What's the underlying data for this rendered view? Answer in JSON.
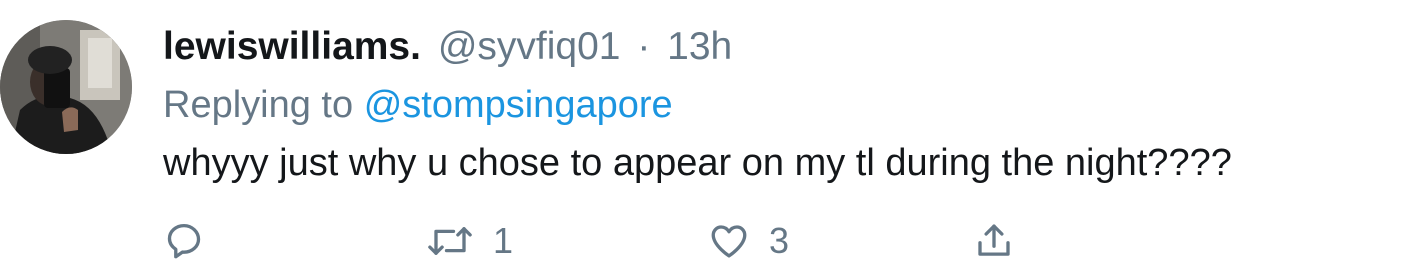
{
  "tweet": {
    "display_name": "lewiswilliams.",
    "handle": "@syvfiq01",
    "separator": "·",
    "time": "13h",
    "replying_prefix": "Replying to",
    "replying_handle": "@stompsingapore",
    "text": "whyyy just why u chose to appear on my tl during the night????"
  },
  "actions": {
    "reply": {
      "icon": "reply-icon",
      "count": ""
    },
    "retweet": {
      "icon": "retweet-icon",
      "count": "1"
    },
    "like": {
      "icon": "heart-icon",
      "count": "3"
    },
    "share": {
      "icon": "share-icon",
      "count": ""
    }
  },
  "colors": {
    "name": "#14171a",
    "secondary": "#657786",
    "link": "#1b95e0",
    "icon": "#657786"
  }
}
